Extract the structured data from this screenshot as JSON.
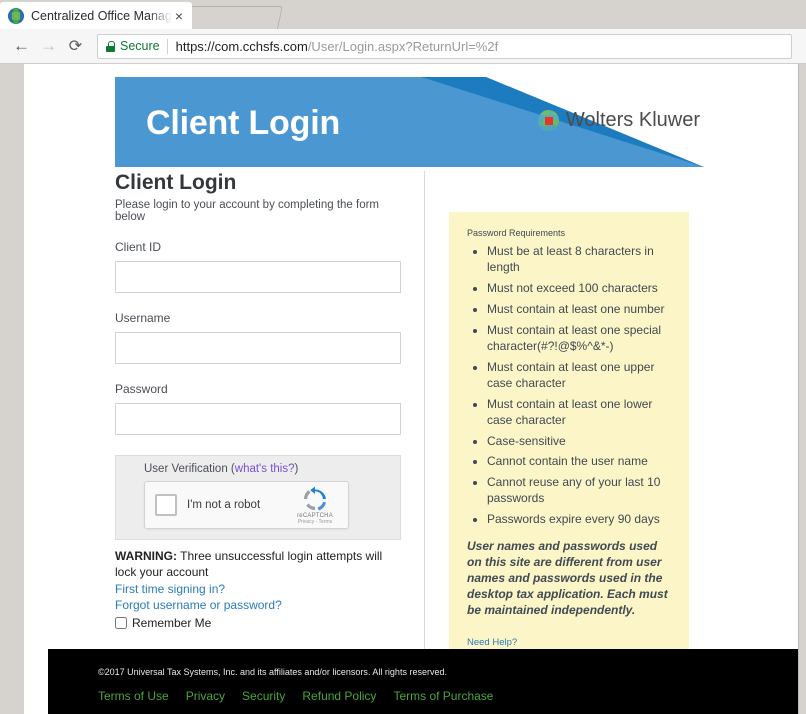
{
  "browser": {
    "tab": {
      "title": "Centralized Office Manag",
      "close_label": "×",
      "favicon": "globe-favicon"
    },
    "nav": {
      "back": "←",
      "forward": "→",
      "reload": "⟳"
    },
    "omnibox": {
      "security_label": "Secure",
      "url_strong": "https://com.cchsfs.com",
      "url_rest": "/User/Login.aspx?ReturnUrl=%2f"
    }
  },
  "banner": {
    "title": "Client Login",
    "brand": "Wolters Kluwer",
    "colors": {
      "dark_blue": "#1d7cbf",
      "light_blue": "#4a97d2"
    }
  },
  "form": {
    "heading": "Client Login",
    "subheading": "Please login to your account by completing the form below",
    "fields": [
      {
        "label": "Client ID",
        "value": "",
        "placeholder": ""
      },
      {
        "label": "Username",
        "value": "",
        "placeholder": ""
      },
      {
        "label": "Password",
        "value": "",
        "placeholder": ""
      }
    ],
    "captcha": {
      "label": "User Verification (",
      "whats_this": "what's this?",
      "label_end": ")",
      "checkbox_text": "I'm not a robot",
      "brand": "reCAPTCHA",
      "brand_links": "Privacy - Terms"
    },
    "warning_bold": "WARNING:",
    "warning_text": " Three unsuccessful login attempts will lock your account",
    "first_time_link": "First time signing in?",
    "forgot_link": "Forgot username or password?",
    "remember_label": "Remember Me"
  },
  "password_panel": {
    "title": "Password Requirements",
    "requirements": [
      "Must be at least 8 characters in length",
      "Must not exceed 100 characters",
      "Must contain at least one number",
      "Must contain at least one special character(#?!@$%^&*-)",
      "Must contain at least one upper case character",
      "Must contain at least one lower case character",
      "Case-sensitive",
      "Cannot contain the user name",
      "Cannot reuse any of your last 10 passwords",
      "Passwords expire every 90 days"
    ],
    "note": "User names and passwords used on this site are different from user names and passwords used in the desktop tax application. Each must be maintained independently.",
    "help_link": "Need Help?",
    "background": "#fcf5c7"
  },
  "footer": {
    "copyright": "©2017 Universal Tax Systems, Inc. and its affiliates and/or licensors. All rights reserved.",
    "links": [
      "Terms of Use",
      "Privacy",
      "Security",
      "Refund Policy",
      "Terms of Purchase"
    ],
    "link_color": "#4aa53a"
  }
}
